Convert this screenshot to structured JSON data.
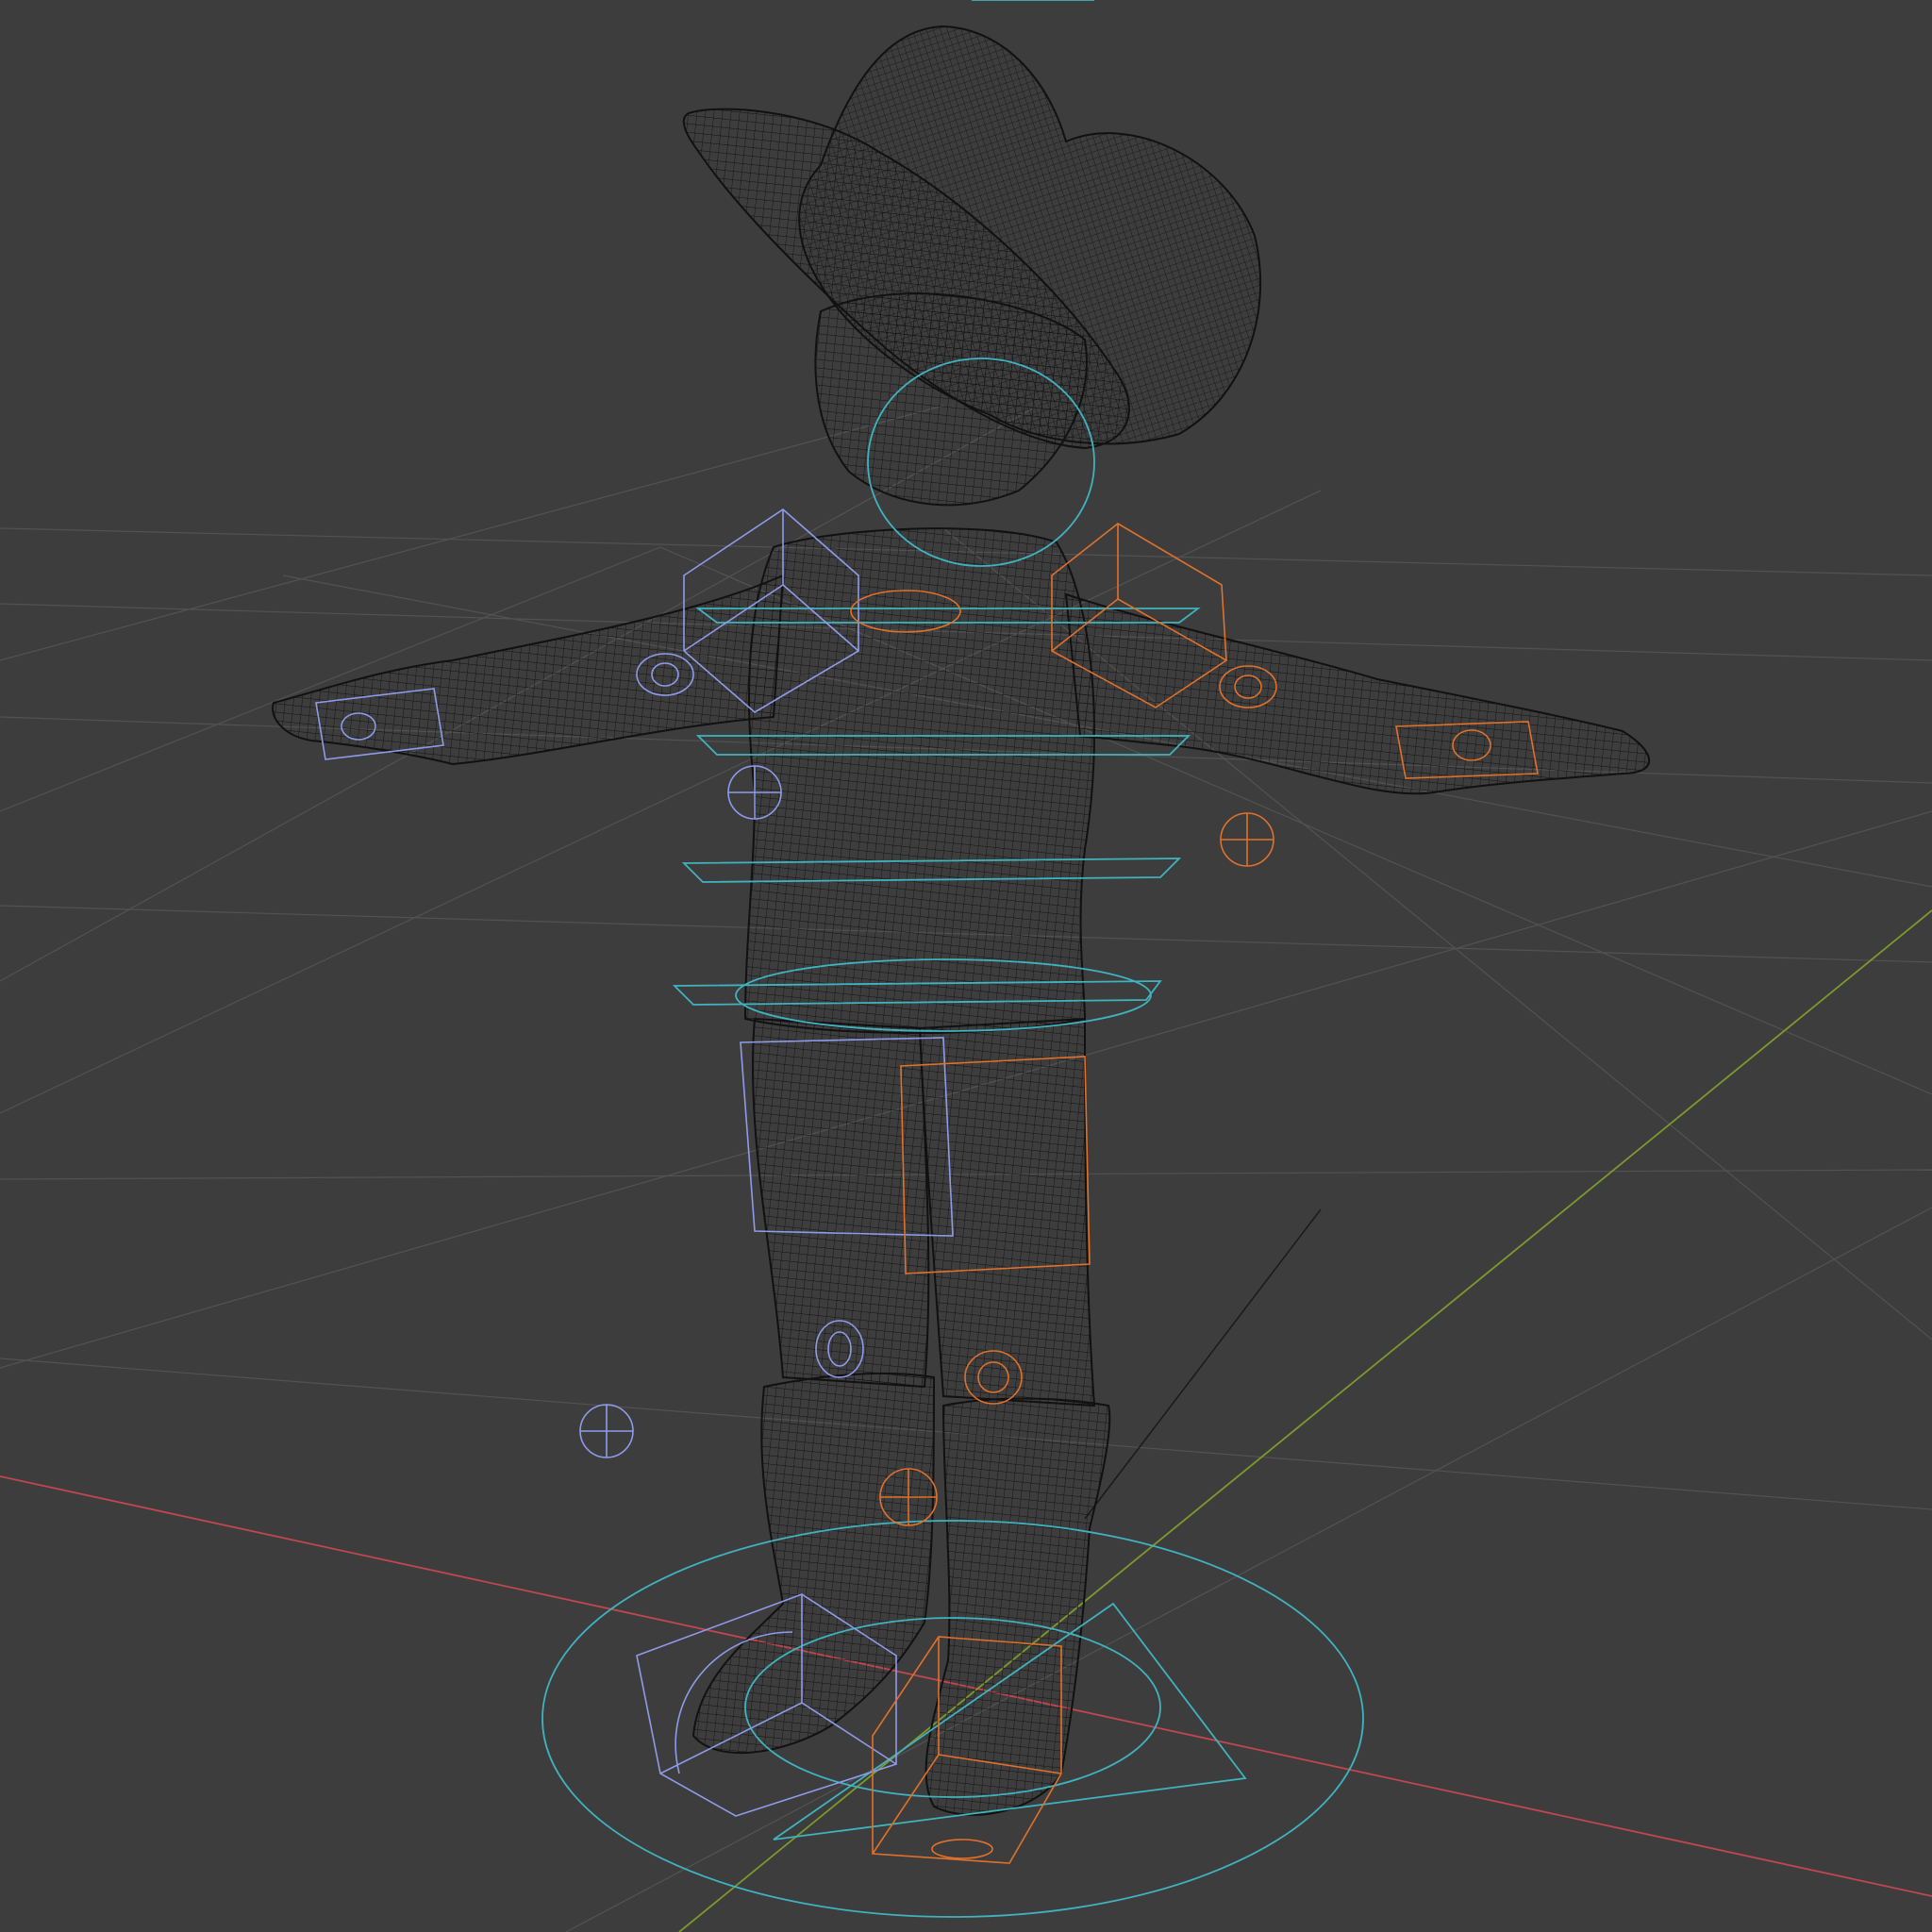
{
  "viewport": {
    "mode": "wireframe",
    "background": "#3d3d3d",
    "grid_color": "#555555",
    "x_axis_color": "#c0474f",
    "y_axis_color": "#7c9a2c"
  },
  "rig": {
    "mesh_color": "#141414",
    "center_control_color": "#3fb3bf",
    "left_control_color": "#8e9bea",
    "right_control_color": "#e0712b"
  }
}
